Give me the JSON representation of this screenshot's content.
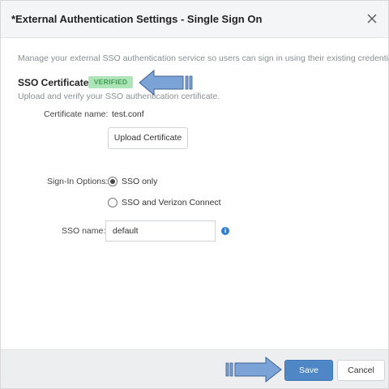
{
  "dialog": {
    "title": "*External Authentication Settings - Single Sign On",
    "description": "Manage your external SSO authentication service so users can sign in using their existing credentials."
  },
  "sso_certificate": {
    "heading": "SSO Certificate",
    "status_badge": "VERIFIED",
    "subtitle": "Upload and verify your SSO authentication certificate.",
    "certificate_label": "Certificate name:",
    "certificate_value": "test.conf",
    "upload_button": "Upload Certificate"
  },
  "sign_in": {
    "label": "Sign-In Options:",
    "options": [
      {
        "label": "SSO only",
        "selected": true
      },
      {
        "label": "SSO and Verizon Connect",
        "selected": false
      }
    ]
  },
  "sso_name": {
    "label": "SSO name:",
    "value": "default"
  },
  "info_icon": "i",
  "footer": {
    "save_label": "Save",
    "cancel_label": "Cancel"
  },
  "colors": {
    "primary": "#4f87c6",
    "badge_bg": "#aee5b8",
    "badge_text": "#3f9c52",
    "annotation_arrow": "#7ba3d8"
  },
  "icons": [
    "close-icon",
    "info-icon",
    "annotation-arrow-icon"
  ]
}
